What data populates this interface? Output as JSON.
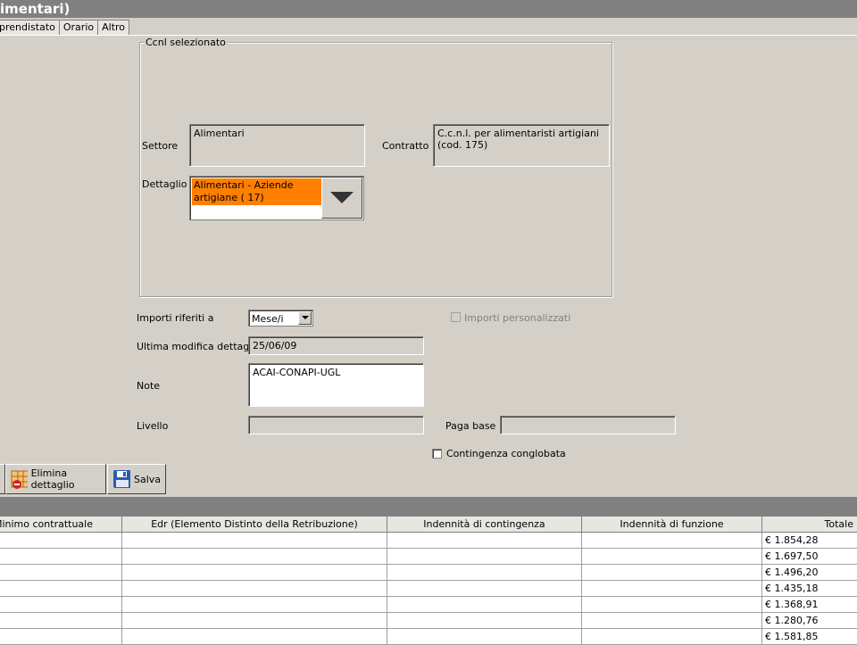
{
  "window": {
    "title": "imentari)"
  },
  "tabs": [
    {
      "label": "prendistato"
    },
    {
      "label": "Orario"
    },
    {
      "label": "Altro"
    }
  ],
  "ccnl_group": {
    "legend": "Ccnl selezionato",
    "settore_label": "Settore",
    "settore_value": "Alimentari",
    "contratto_label": "Contratto",
    "contratto_value": "C.c.n.l. per alimentaristi artigiani (cod. 175)",
    "dettaglio_label": "Dettaglio",
    "dettaglio_selected": "Alimentari - Aziende artigiane ( 17)"
  },
  "form": {
    "importi_label": "Importi riferiti a",
    "importi_value": "Mese/i",
    "importi_personalizzati_label": "Importi personalizzati",
    "ultima_modifica_label": "Ultima modifica dettaglio",
    "ultima_modifica_value": "25/06/09",
    "note_label": "Note",
    "note_value": "ACAI-CONAPI-UGL",
    "livello_label": "Livello",
    "livello_value": "",
    "paga_base_label": "Paga base",
    "paga_base_value": "",
    "contingenza_label": "Contingenza conglobata"
  },
  "toolbar": {
    "elimina_label": "Elimina dettaglio",
    "salva_label": "Salva"
  },
  "grid": {
    "columns": [
      "Minimo contrattuale",
      "Edr (Elemento Distinto della Retribuzione)",
      "Indennità di contingenza",
      "Indennità di funzione",
      "Totale"
    ],
    "rows": [
      [
        "",
        "",
        "",
        "",
        "€ 1.854,28"
      ],
      [
        "",
        "",
        "",
        "",
        "€ 1.697,50"
      ],
      [
        "",
        "",
        "",
        "",
        "€ 1.496,20"
      ],
      [
        "",
        "",
        "",
        "",
        "€ 1.435,18"
      ],
      [
        "",
        "",
        "",
        "",
        "€ 1.368,91"
      ],
      [
        "",
        "",
        "",
        "",
        "€ 1.280,76"
      ],
      [
        "",
        "",
        "",
        "",
        "€ 1.581,85"
      ]
    ]
  },
  "colors": {
    "title_bar": "#808080",
    "selection": "#ff7f00",
    "background": "#d4d0c8"
  }
}
